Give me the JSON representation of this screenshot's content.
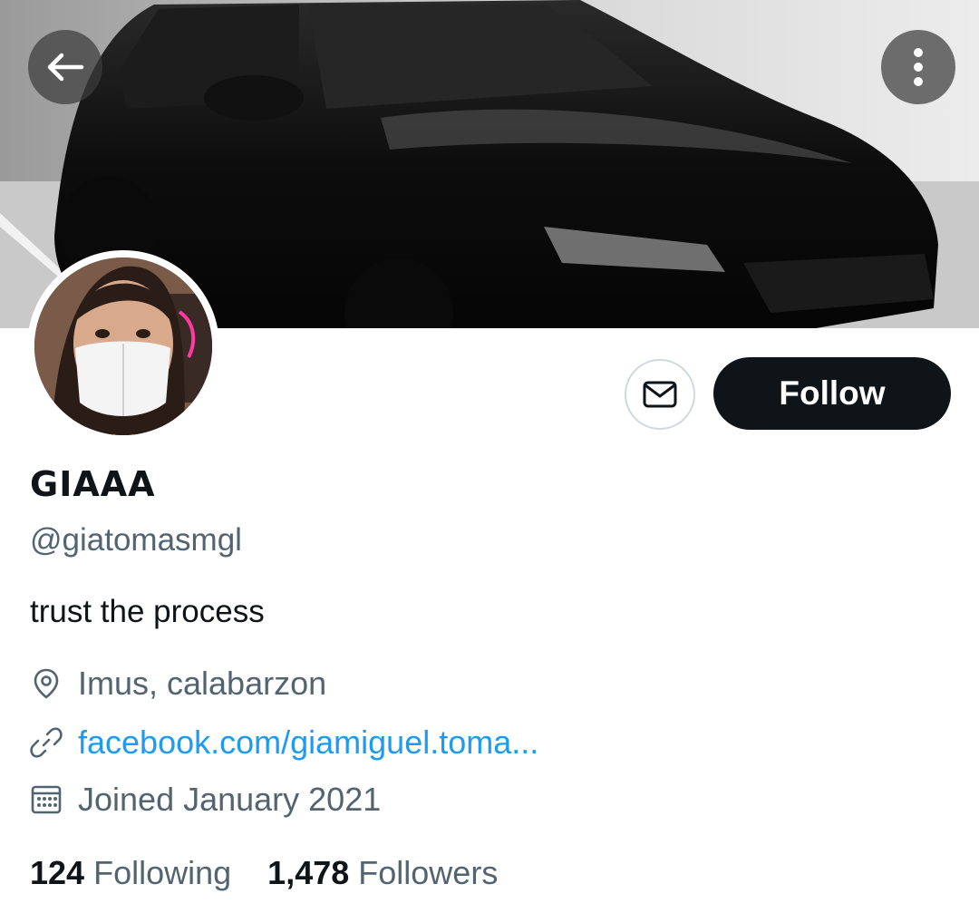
{
  "profile": {
    "name": "GIAAA",
    "handle": "@giatomasmgl",
    "bio": "trust the process",
    "location": "Imus, calabarzon",
    "website": "facebook.com/giamiguel.toma...",
    "joined": "Joined January 2021"
  },
  "actions": {
    "follow_label": "Follow"
  },
  "stats": {
    "following_count": "124",
    "following_label": "Following",
    "followers_count": "1,478",
    "followers_label": "Followers"
  },
  "icons": {
    "back": "arrow-left-icon",
    "more": "more-vertical-icon",
    "message": "envelope-icon",
    "location": "location-pin-icon",
    "link": "link-icon",
    "calendar": "calendar-icon"
  },
  "colors": {
    "follow_bg": "#0f1419",
    "link": "#1d9bf0",
    "secondary_text": "#536471"
  }
}
